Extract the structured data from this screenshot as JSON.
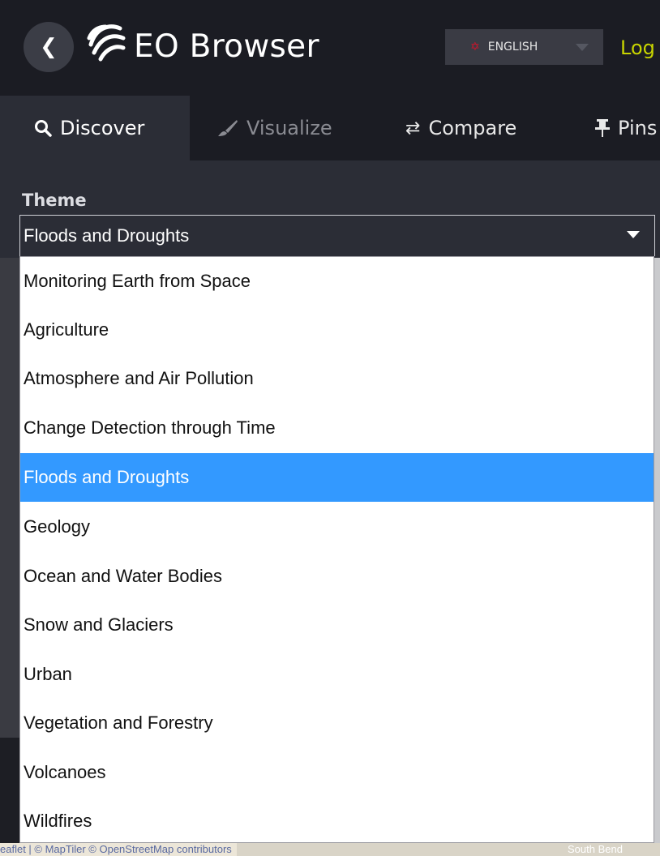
{
  "header": {
    "back_icon": "chevron-left-icon",
    "logo_icon": "eo-browser-logo",
    "brand": "EO Browser",
    "language": {
      "flag_icon": "uk-flag-icon",
      "label": "ENGLISH"
    },
    "login": "Log"
  },
  "tabs": [
    {
      "label": "Discover",
      "icon": "search-icon",
      "active": true
    },
    {
      "label": "Visualize",
      "icon": "brush-icon",
      "active": false
    },
    {
      "label": "Compare",
      "icon": "swap-arrows-icon",
      "active": false
    },
    {
      "label": "Pins",
      "icon": "pin-icon",
      "active": false
    }
  ],
  "theme": {
    "label": "Theme",
    "selected": "Floods and Droughts",
    "options": [
      "Monitoring Earth from Space",
      "Agriculture",
      "Atmosphere and Air Pollution",
      "Change Detection through Time",
      "Floods and Droughts",
      "Geology",
      "Ocean and Water Bodies",
      "Snow and Glaciers",
      "Urban",
      "Vegetation and Forestry",
      "Volcanoes",
      "Wildfires"
    ],
    "highlighted_index": 4
  },
  "map": {
    "attribution": "eaflet | © MapTiler © OpenStreetMap contributors",
    "place_label": "South Bend"
  },
  "colors": {
    "accent": "#3399ff",
    "login": "#c8d400",
    "header_bg": "#1b1c23",
    "panel_bg": "#2b2d36"
  }
}
